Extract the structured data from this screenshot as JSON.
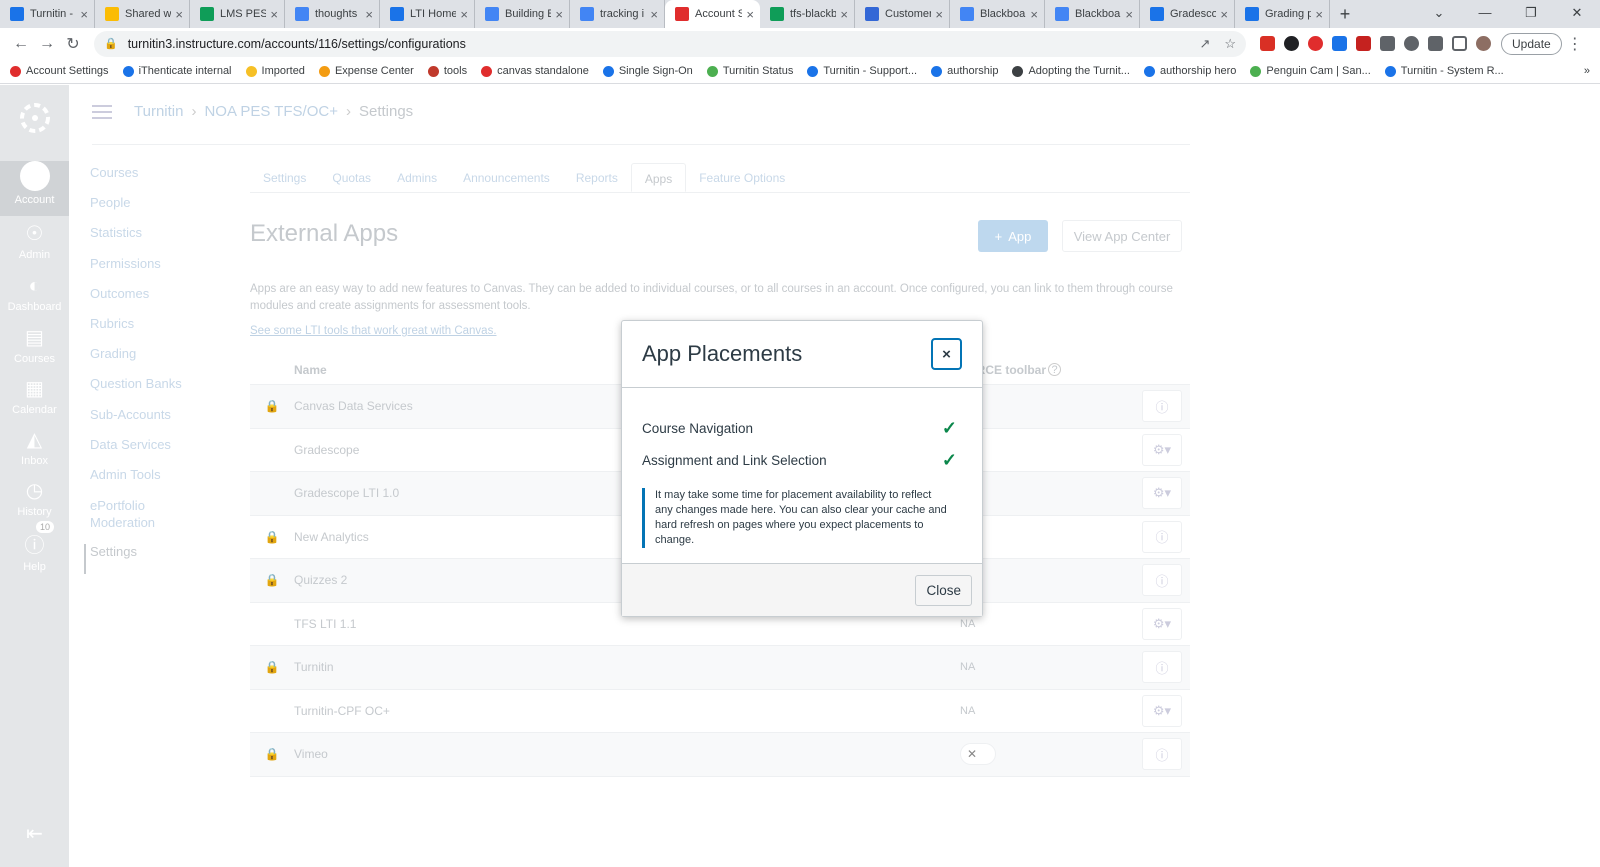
{
  "browser": {
    "tabs": [
      {
        "title": "Turnitin -",
        "color": "#1a73e8"
      },
      {
        "title": "Shared wi",
        "color": "#fbbc04"
      },
      {
        "title": "LMS PES D",
        "color": "#0f9d58"
      },
      {
        "title": "thoughts",
        "color": "#4285f4"
      },
      {
        "title": "LTI Home",
        "color": "#1a73e8"
      },
      {
        "title": "Building E",
        "color": "#4285f4"
      },
      {
        "title": "tracking i",
        "color": "#4285f4"
      },
      {
        "title": "Account S",
        "color": "#e02d2d"
      },
      {
        "title": "tfs-blackb",
        "color": "#0f9d58"
      },
      {
        "title": "Customer",
        "color": "#3367d6"
      },
      {
        "title": "Blackboar",
        "color": "#4285f4"
      },
      {
        "title": "Blackboar",
        "color": "#4285f4"
      },
      {
        "title": "Gradescop",
        "color": "#1a73e8"
      },
      {
        "title": "Grading p",
        "color": "#1a73e8"
      }
    ],
    "active_tab_index": 7,
    "url": "turnitin3.instructure.com/accounts/116/settings/configurations",
    "update_label": "Update",
    "bookmarks": [
      {
        "label": "Account Settings",
        "color": "#e02d2d"
      },
      {
        "label": "iThenticate internal",
        "color": "#1a73e8"
      },
      {
        "label": "Imported",
        "color": "#f6c026"
      },
      {
        "label": "Expense Center",
        "color": "#f39c12"
      },
      {
        "label": "tools",
        "color": "#c0392b"
      },
      {
        "label": "canvas standalone",
        "color": "#e02d2d"
      },
      {
        "label": "Single Sign-On",
        "color": "#1a73e8"
      },
      {
        "label": "Turnitin Status",
        "color": "#4caf50"
      },
      {
        "label": "Turnitin - Support...",
        "color": "#1a73e8"
      },
      {
        "label": "authorship",
        "color": "#1a73e8"
      },
      {
        "label": "Adopting the Turnit...",
        "color": "#3c4043"
      },
      {
        "label": "authorship hero",
        "color": "#1a73e8"
      },
      {
        "label": "Penguin Cam | San...",
        "color": "#4caf50"
      },
      {
        "label": "Turnitin - System R...",
        "color": "#1a73e8"
      }
    ]
  },
  "global_nav": {
    "account": "Account",
    "admin": "Admin",
    "dashboard": "Dashboard",
    "courses": "Courses",
    "calendar": "Calendar",
    "inbox": "Inbox",
    "history": "History",
    "help": "Help",
    "help_badge": "10"
  },
  "breadcrumb": {
    "root": "Turnitin",
    "account": "NOA PES TFS/OC+",
    "current": "Settings"
  },
  "left_nav": [
    "Courses",
    "People",
    "Statistics",
    "Permissions",
    "Outcomes",
    "Rubrics",
    "Grading",
    "Question Banks",
    "Sub-Accounts",
    "Data Services",
    "Admin Tools",
    "ePortfolio Moderation",
    "Settings"
  ],
  "settings_tabs": [
    "Settings",
    "Quotas",
    "Admins",
    "Announcements",
    "Reports",
    "Apps",
    "Feature Options"
  ],
  "active_settings_tab": "Apps",
  "external_apps": {
    "heading": "External Apps",
    "add_label": "App",
    "view_center_label": "View App Center",
    "description": "Apps are an easy way to add new features to Canvas. They can be added to individual courses, or to all courses in an account. Once configured, you can link to them through course modules and create assignments for assessment tools.",
    "link": "See some LTI tools that work great with Canvas.",
    "col_name": "Name",
    "col_rce": "to RCE toolbar",
    "rows": [
      {
        "name": "Canvas Data Services",
        "locked": true,
        "rce": "",
        "action": "info"
      },
      {
        "name": "Gradescope",
        "locked": false,
        "rce": "",
        "action": "gear"
      },
      {
        "name": "Gradescope LTI 1.0",
        "locked": false,
        "rce": "",
        "action": "gear"
      },
      {
        "name": "New Analytics",
        "locked": true,
        "rce": "",
        "action": "info"
      },
      {
        "name": "Quizzes 2",
        "locked": true,
        "rce": "",
        "action": "info"
      },
      {
        "name": "TFS LTI 1.1",
        "locked": false,
        "rce": "NA",
        "action": "gear"
      },
      {
        "name": "Turnitin",
        "locked": true,
        "rce": "NA",
        "action": "info"
      },
      {
        "name": "Turnitin-CPF OC+",
        "locked": false,
        "rce": "NA",
        "action": "gear"
      },
      {
        "name": "Vimeo",
        "locked": true,
        "rce": "toggle",
        "action": "info"
      }
    ]
  },
  "modal": {
    "title": "App Placements",
    "close_x": "×",
    "placements": [
      {
        "label": "Course Navigation",
        "enabled": true
      },
      {
        "label": "Assignment and Link Selection",
        "enabled": true
      }
    ],
    "note": "It may take some time for placement availability to reflect any changes made here. You can also clear your cache and hard refresh on pages where you expect placements to change.",
    "close_button": "Close",
    "accent_color": "#0374b5",
    "check_color": "#0b874b"
  }
}
